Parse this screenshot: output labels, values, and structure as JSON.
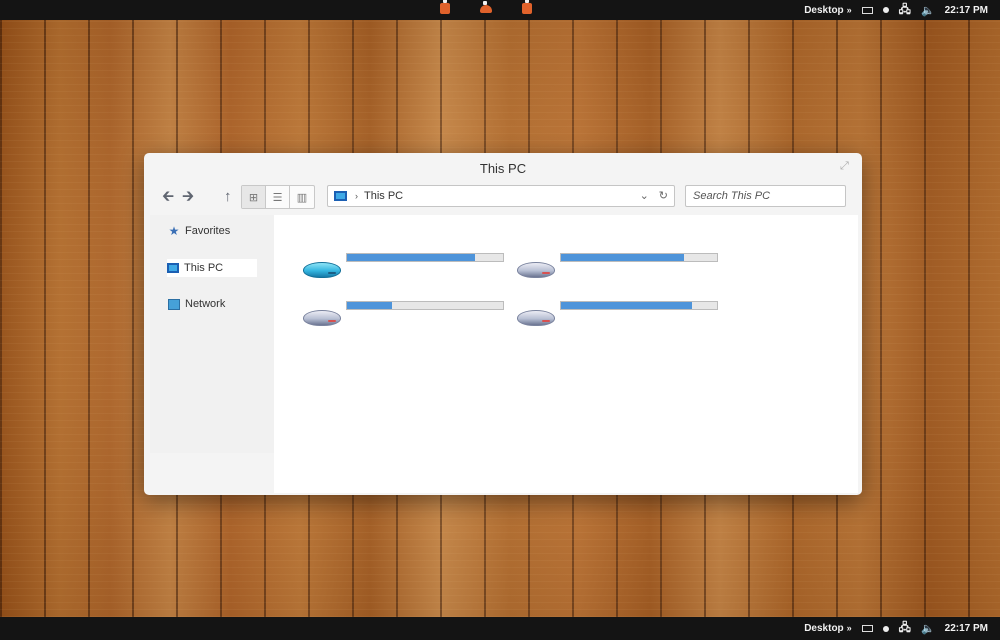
{
  "taskbar_top": {
    "desktop_label": "Desktop",
    "chevron": "»",
    "clock": "22:17 PM"
  },
  "taskbar_bottom": {
    "desktop_label": "Desktop",
    "chevron": "»",
    "clock": "22:17 PM"
  },
  "center_icons": [
    "app-icon",
    "cloud-icon",
    "clipboard-icon"
  ],
  "window": {
    "title": "This PC",
    "back": "🡰",
    "forward": "🡲",
    "up": "↑",
    "views": [
      "⊞",
      "☰",
      "▥"
    ],
    "address": {
      "breadcrumb_sep": "›",
      "location": "This PC",
      "dropdown": "⌄",
      "refresh": "↻"
    },
    "search_placeholder": "Search This PC",
    "sidebar": [
      {
        "label": "Favorites",
        "icon": "star-icon"
      },
      {
        "label": "This PC",
        "icon": "computer-icon",
        "selected": true
      },
      {
        "label": "Network",
        "icon": "network-icon"
      }
    ],
    "drives": [
      {
        "used": 0.82,
        "type": "system"
      },
      {
        "used": 0.79,
        "type": "disk"
      },
      {
        "used": 0.29,
        "type": "disk"
      },
      {
        "used": 0.84,
        "type": "disk"
      }
    ]
  },
  "colors": {
    "accent": "#4e94da",
    "taskbar": "#141414",
    "window_bg": "#f4f4f4"
  }
}
